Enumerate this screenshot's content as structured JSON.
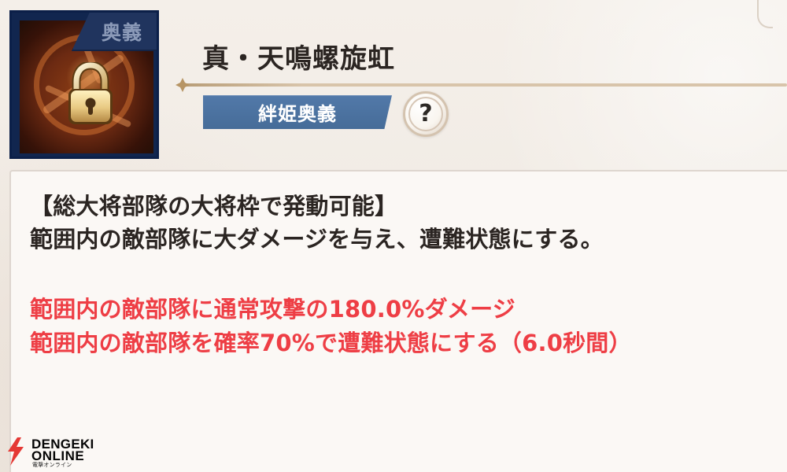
{
  "skill": {
    "lock_label": "奥義",
    "title": "真・天鳴螺旋虹",
    "type_label": "絆姫奥義",
    "help_label": "?"
  },
  "description": {
    "condition": "【総大将部隊の大将枠で発動可能】",
    "summary": "範囲内の敵部隊に大ダメージを与え、遭難状態にする。",
    "effect_1": "範囲内の敵部隊に通常攻撃の180.0%ダメージ",
    "effect_2": "範囲内の敵部隊を確率70%で遭難状態にする（6.0秒間）"
  },
  "watermark": {
    "line_1": "DENGEKI",
    "line_2": "ONLINE",
    "line_3": "電撃オンライン"
  },
  "icons": {
    "lock": "lock-icon",
    "help": "question-mark-icon",
    "brand": "lightning-icon"
  },
  "colors": {
    "panel_background": "#fbf8f5",
    "accent_blue": "#466c98",
    "effect_red": "#ee3e45"
  }
}
